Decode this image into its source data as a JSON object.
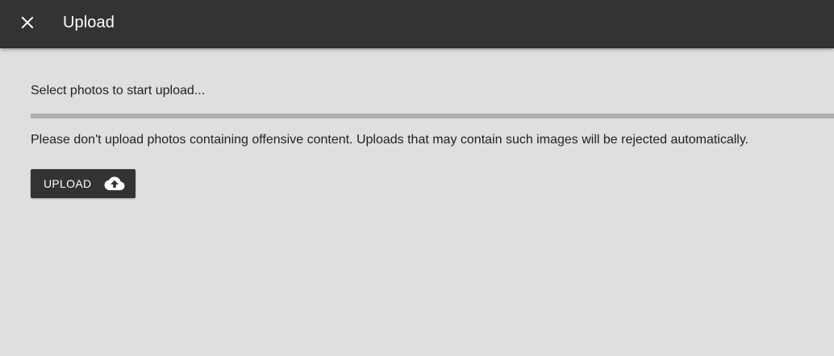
{
  "header": {
    "close_icon": "close-icon",
    "title": "Upload"
  },
  "main": {
    "status_text": "Select photos to start upload...",
    "progress_percent": 0,
    "notice_text": "Please don't upload photos containing offensive content. Uploads that may contain such images will be rejected automatically.",
    "upload_button": {
      "label": "UPLOAD",
      "icon": "cloud-upload-icon"
    }
  },
  "colors": {
    "toolbar": "#333334",
    "background": "#e0dfde",
    "progress_track": "#b0aead",
    "button": "#333334"
  }
}
